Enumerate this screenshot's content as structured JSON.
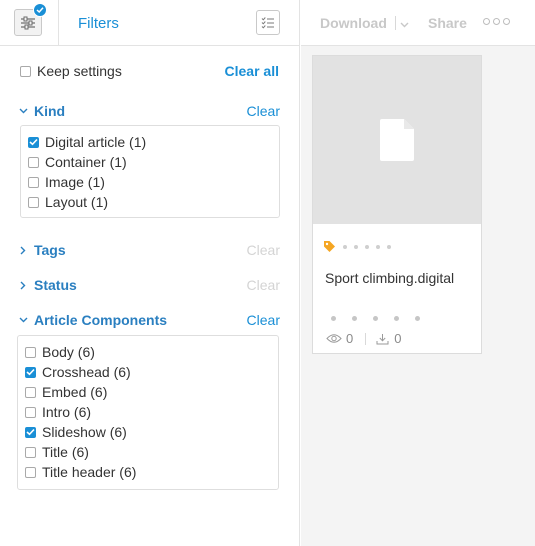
{
  "header": {
    "title": "Filters",
    "filter_toggle_icon": "sliders-icon",
    "badge_icon": "check-icon",
    "checklist_icon": "checklist-icon"
  },
  "keep_settings": {
    "label": "Keep settings",
    "checked": false
  },
  "clear_all_label": "Clear all",
  "sections": {
    "kind": {
      "title": "Kind",
      "clear_label": "Clear",
      "expanded": true,
      "options": [
        {
          "label": "Digital article (1)",
          "checked": true
        },
        {
          "label": "Container (1)",
          "checked": false
        },
        {
          "label": "Image (1)",
          "checked": false
        },
        {
          "label": "Layout (1)",
          "checked": false
        }
      ]
    },
    "tags": {
      "title": "Tags",
      "clear_label": "Clear",
      "expanded": false
    },
    "status": {
      "title": "Status",
      "clear_label": "Clear",
      "expanded": false
    },
    "article_components": {
      "title": "Article Components",
      "clear_label": "Clear",
      "expanded": true,
      "options": [
        {
          "label": "Body (6)",
          "checked": false
        },
        {
          "label": "Crosshead (6)",
          "checked": true
        },
        {
          "label": "Embed (6)",
          "checked": false
        },
        {
          "label": "Intro (6)",
          "checked": false
        },
        {
          "label": "Slideshow (6)",
          "checked": true
        },
        {
          "label": "Title (6)",
          "checked": false
        },
        {
          "label": "Title header (6)",
          "checked": false
        }
      ]
    }
  },
  "toolbar": {
    "download_label": "Download",
    "share_label": "Share",
    "more_icon": "more-horizontal-icon"
  },
  "card": {
    "title": "Sport climbing.digital",
    "file_icon": "file-icon",
    "tag_icon": "tag-icon",
    "views": "0",
    "downloads": "0"
  },
  "colors": {
    "accent": "#1a8fd6",
    "heading": "#2a7fc0",
    "disabled": "#d4d4d4",
    "tag": "#f5a623"
  }
}
